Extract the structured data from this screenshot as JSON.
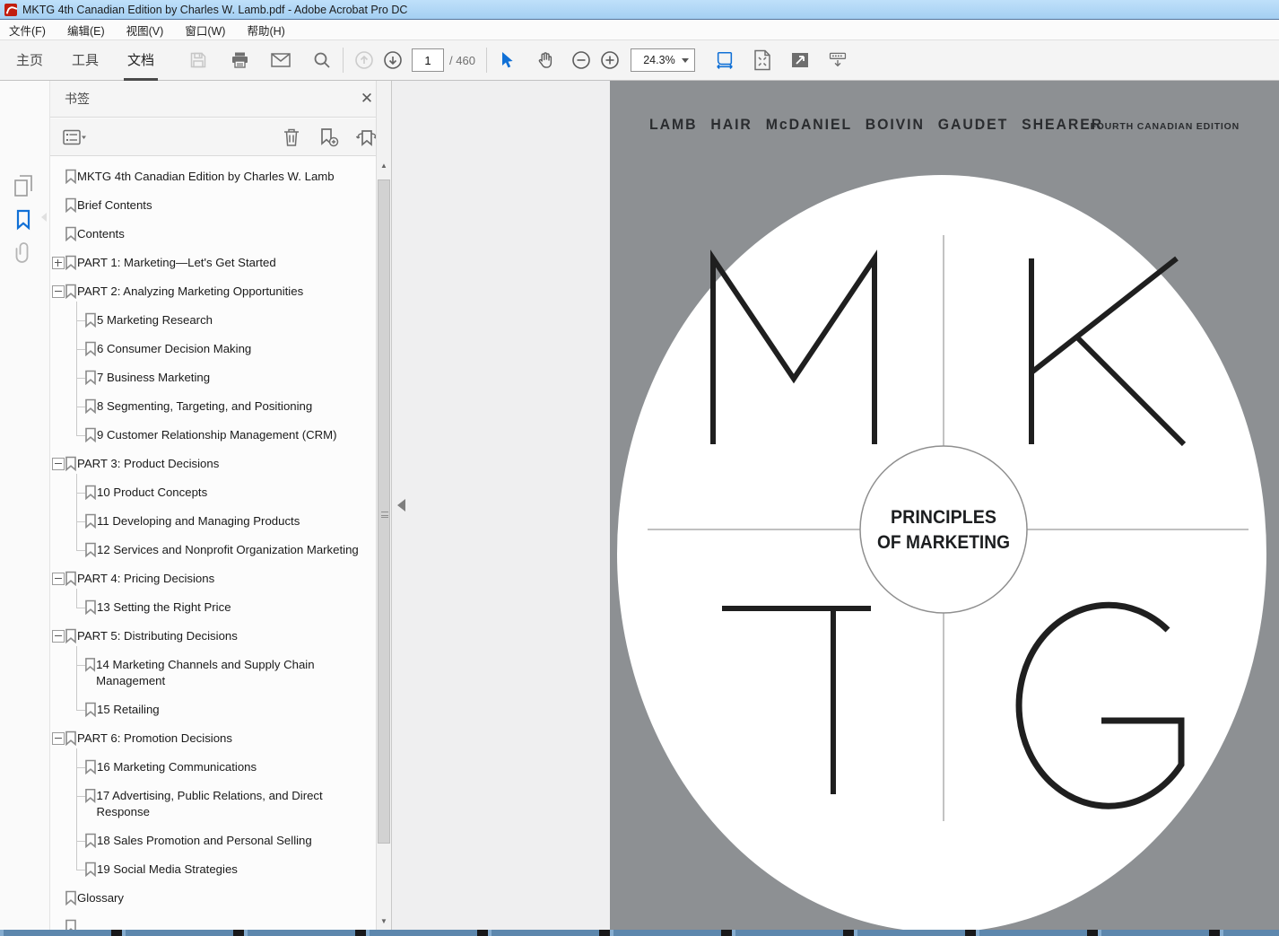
{
  "window": {
    "title": "MKTG 4th Canadian Edition by Charles W. Lamb.pdf - Adobe Acrobat Pro DC"
  },
  "menubar": {
    "items": [
      "文件(F)",
      "编辑(E)",
      "视图(V)",
      "窗口(W)",
      "帮助(H)"
    ]
  },
  "toolbar": {
    "tabs": [
      "主页",
      "工具",
      "文档"
    ],
    "active_tab": "文档",
    "page_number": "1",
    "page_count": "/ 460",
    "zoom_level": "24.3%"
  },
  "sidebar": {
    "panels": [
      "page-thumbnails",
      "bookmarks",
      "attachments"
    ],
    "active_panel": "bookmarks"
  },
  "bookmarks_panel": {
    "title": "书签",
    "close_label": "✕",
    "items": [
      {
        "label": "MKTG 4th Canadian Edition by Charles W. Lamb"
      },
      {
        "label": "Brief Contents"
      },
      {
        "label": "Contents"
      },
      {
        "label": "PART 1: Marketing—Let's Get Started",
        "collapsed": true,
        "children": []
      },
      {
        "label": "PART 2: Analyzing Marketing Opportunities",
        "children": [
          {
            "label": "5 Marketing Research"
          },
          {
            "label": "6 Consumer Decision Making"
          },
          {
            "label": "7 Business Marketing"
          },
          {
            "label": "8 Segmenting, Targeting, and Positioning"
          },
          {
            "label": "9 Customer Relationship Management (CRM)"
          }
        ]
      },
      {
        "label": "PART 3: Product Decisions",
        "children": [
          {
            "label": "10 Product Concepts"
          },
          {
            "label": "11 Developing and Managing Products"
          },
          {
            "label": "12 Services and Nonprofit Organization Marketing"
          }
        ]
      },
      {
        "label": "PART 4: Pricing Decisions",
        "children": [
          {
            "label": "13 Setting the Right Price"
          }
        ]
      },
      {
        "label": "PART 5: Distributing Decisions",
        "children": [
          {
            "label": "14 Marketing Channels and Supply Chain Management"
          },
          {
            "label": "15 Retailing"
          }
        ]
      },
      {
        "label": "PART 6: Promotion Decisions",
        "children": [
          {
            "label": "16 Marketing Communications"
          },
          {
            "label": "17 Advertising, Public Relations, and Direct Response"
          },
          {
            "label": "18 Sales Promotion and Personal Selling"
          },
          {
            "label": "19 Social Media Strategies"
          }
        ]
      },
      {
        "label": "Glossary"
      },
      {
        "label": "",
        "partial": true
      }
    ]
  },
  "cover": {
    "authors": "LAMB HAIR McDANIEL BOIVIN GAUDET SHEARER",
    "edition": "FOURTH CANADIAN EDITION",
    "letters": "MKTG",
    "circle_line1": "PRINCIPLES",
    "circle_line2": "OF MARKETING"
  },
  "colors": {
    "titlebar": "#aed4f4",
    "accent_blue": "#1070d6",
    "cover_bg": "#8d9093",
    "cover_ink": "#1f1f1f"
  }
}
